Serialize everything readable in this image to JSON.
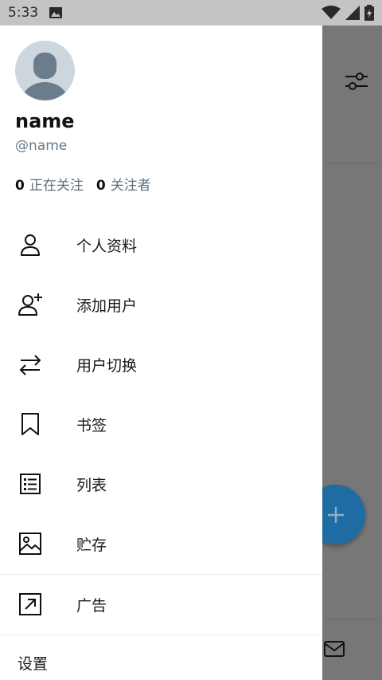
{
  "status_bar": {
    "time": "5:33"
  },
  "profile": {
    "name": "name",
    "handle": "@name",
    "following_count": "0",
    "following_label": "正在关注",
    "followers_count": "0",
    "followers_label": "关注者"
  },
  "menu": {
    "items": [
      {
        "label": "个人资料",
        "icon": "person-icon"
      },
      {
        "label": "添加用户",
        "icon": "add-user-icon"
      },
      {
        "label": "用户切换",
        "icon": "switch-icon"
      },
      {
        "label": "书签",
        "icon": "bookmark-icon"
      },
      {
        "label": "列表",
        "icon": "list-icon"
      },
      {
        "label": "贮存",
        "icon": "image-icon"
      },
      {
        "label": "广告",
        "icon": "external-link-icon"
      }
    ],
    "settings_label": "设置"
  },
  "colors": {
    "accent": "#1f6ca3",
    "handle": "#677886",
    "scrim": "#777777"
  }
}
